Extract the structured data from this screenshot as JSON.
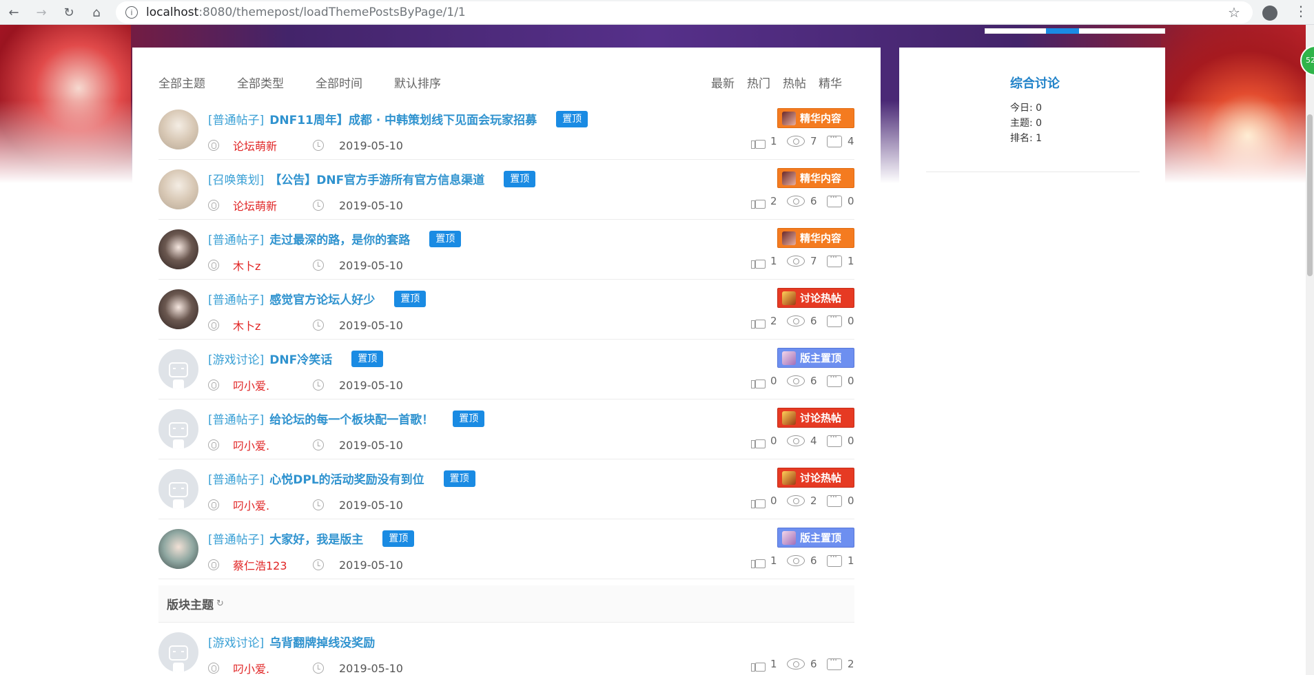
{
  "browser": {
    "url_host": "localhost",
    "url_path": ":8080/themepost/loadThemePostsByPage/1/1"
  },
  "filters": {
    "left": [
      "全部主题",
      "全部类型",
      "全部时间",
      "默认排序"
    ],
    "right": [
      "最新",
      "热门",
      "热帖",
      "精华"
    ]
  },
  "posts": [
    {
      "type": "[普通帖子]",
      "title": "DNF11周年】成都 · 中韩策划线下见面会玩家招募",
      "pin": "置顶",
      "author": "论坛萌新",
      "date": "2019-05-10",
      "badge": "精华内容",
      "badge_color": "#f47b20",
      "likes": "1",
      "views": "7",
      "comments": "4"
    },
    {
      "type": "[召唤策划]",
      "title": "【公告】DNF官方手游所有官方信息渠道",
      "pin": "置顶",
      "author": "论坛萌新",
      "date": "2019-05-10",
      "badge": "精华内容",
      "badge_color": "#f47b20",
      "likes": "2",
      "views": "6",
      "comments": "0"
    },
    {
      "type": "[普通帖子]",
      "title": "走过最深的路，是你的套路",
      "pin": "置顶",
      "author": "木卜z",
      "date": "2019-05-10",
      "badge": "精华内容",
      "badge_color": "#f47b20",
      "likes": "1",
      "views": "7",
      "comments": "1"
    },
    {
      "type": "[普通帖子]",
      "title": "感觉官方论坛人好少",
      "pin": "置顶",
      "author": "木卜z",
      "date": "2019-05-10",
      "badge": "讨论热帖",
      "badge_color": "#e63a23",
      "likes": "2",
      "views": "6",
      "comments": "0"
    },
    {
      "type": "[游戏讨论]",
      "title": "DNF冷笑话",
      "pin": "置顶",
      "author": "叼小爱.",
      "date": "2019-05-10",
      "badge": "版主置顶",
      "badge_color": "#6d8ff0",
      "likes": "0",
      "views": "6",
      "comments": "0"
    },
    {
      "type": "[普通帖子]",
      "title": "给论坛的每一个板块配一首歌！",
      "pin": "置顶",
      "author": "叼小爱.",
      "date": "2019-05-10",
      "badge": "讨论热帖",
      "badge_color": "#e63a23",
      "likes": "0",
      "views": "4",
      "comments": "0"
    },
    {
      "type": "[普通帖子]",
      "title": "心悦DPL的活动奖励没有到位",
      "pin": "置顶",
      "author": "叼小爱.",
      "date": "2019-05-10",
      "badge": "讨论热帖",
      "badge_color": "#e63a23",
      "likes": "0",
      "views": "2",
      "comments": "0"
    },
    {
      "type": "[普通帖子]",
      "title": "大家好，我是版主",
      "pin": "置顶",
      "author": "蔡仁浩123",
      "date": "2019-05-10",
      "badge": "版主置顶",
      "badge_color": "#6d8ff0",
      "likes": "1",
      "views": "6",
      "comments": "1"
    }
  ],
  "section": {
    "title": "版块主题",
    "refresh_icon": "refresh-icon"
  },
  "section_posts": [
    {
      "type": "[游戏讨论]",
      "title": "乌背翻牌掉线没奖励",
      "author": "叼小爱.",
      "date": "2019-05-10",
      "likes": "1",
      "views": "6",
      "comments": "2"
    }
  ],
  "sidebar": {
    "name": "综合讨论",
    "today": "今日: 0",
    "topics": "主题: 0",
    "rank": "排名: 1"
  }
}
